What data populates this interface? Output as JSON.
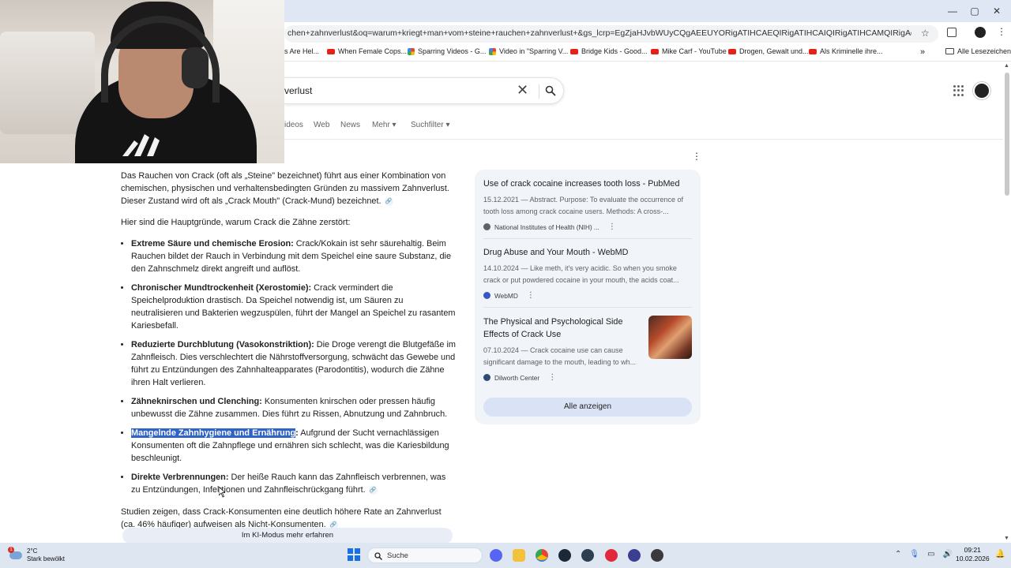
{
  "browser": {
    "url": "chen+zahnverlust&oq=warum+kriegt+man+vom+steine+rauchen+zahnverlust+&gs_lcrp=EgZjaHJvbWUyCQgAEEUYORigATIHCAEQIRigATIHCAIQIRigATIHCAMQIRigAdIBCDc1NzNqMGo3qAIAsAI...",
    "bookmarks": [
      {
        "label": "s Are Hel...",
        "icon": "none"
      },
      {
        "label": "When Female Cops...",
        "icon": "youtube"
      },
      {
        "label": "Sparring Videos - G...",
        "icon": "google-drive"
      },
      {
        "label": "Video in \"Sparring V...",
        "icon": "google-drive"
      },
      {
        "label": "Bridge Kids - Good...",
        "icon": "youtube"
      },
      {
        "label": "Mike Carf - YouTube",
        "icon": "youtube"
      },
      {
        "label": "Drogen, Gewalt und...",
        "icon": "youtube"
      },
      {
        "label": "Als Kriminelle ihre...",
        "icon": "youtube"
      }
    ],
    "bookmarks_more": "»",
    "all_bookmarks": "Alle Lesezeichen",
    "window_controls": {
      "minimize": "—",
      "maximize": "▢",
      "close": "✕"
    }
  },
  "search": {
    "query": "verlust",
    "clear": "✕",
    "tabs": [
      "ideos",
      "Web",
      "News",
      "Mehr ▾",
      "Suchfilter ▾"
    ]
  },
  "main": {
    "intro": "Das Rauchen von Crack (oft als „Steine\" bezeichnet) führt aus einer Kombination von chemischen, physischen und verhaltensbedingten Gründen zu massivem Zahnverlust. Dieser Zustand wird oft als „Crack Mouth\" (Crack-Mund) bezeichnet.",
    "lead": "Hier sind die Hauptgründe, warum Crack die Zähne zerstört:",
    "items": [
      {
        "bold": "Extreme Säure und chemische Erosion:",
        "text": " Crack/Kokain ist sehr säurehaltig. Beim Rauchen bildet der Rauch in Verbindung mit dem Speichel eine saure Substanz, die den Zahnschmelz direkt angreift und auflöst."
      },
      {
        "bold": "Chronischer Mundtrockenheit (Xerostomie):",
        "text": " Crack vermindert die Speichelproduktion drastisch. Da Speichel notwendig ist, um Säuren zu neutralisieren und Bakterien wegzuspülen, führt der Mangel an Speichel zu rasantem Kariesbefall."
      },
      {
        "bold": "Reduzierte Durchblutung (Vasokonstriktion):",
        "text": " Die Droge verengt die Blutgefäße im Zahnfleisch. Dies verschlechtert die Nährstoffversorgung, schwächt das Gewebe und führt zu Entzündungen des Zahnhalteapparates (Parodontitis), wodurch die Zähne ihren Halt verlieren."
      },
      {
        "bold": "Zähneknirschen und Clenching:",
        "text": " Konsumenten knirschen oder pressen häufig unbewusst die Zähne zusammen. Dies führt zu Rissen, Abnutzung und Zahnbruch."
      },
      {
        "bold": "Mangelnde Zahnhygiene und Ernährung",
        "bold_suffix": ":",
        "text": " Aufgrund der Sucht vernachlässigen Konsumenten oft die Zahnpflege und ernähren sich schlecht, was die Kariesbildung beschleunigt."
      },
      {
        "bold": "Direkte Verbrennungen:",
        "text": " Der heiße Rauch kann das Zahnfleisch verbrennen, was zu Entzündungen, Infektionen und Zahnfleischrückgang führt."
      }
    ],
    "outro": "Studien zeigen, dass Crack-Konsumenten eine deutlich höhere Rate an Zahnverlust (ca. 46% häufiger) aufweisen als Nicht-Konsumenten.",
    "ai_mode_button": "Im KI-Modus mehr erfahren"
  },
  "sources": {
    "cards": [
      {
        "title": "Use of crack cocaine increases tooth loss - PubMed",
        "snippet": "15.12.2021 — Abstract. Purpose: To evaluate the occurrence of tooth loss among crack cocaine users. Methods: A cross-...",
        "source": "National Institutes of Health (NIH) ...",
        "color": "#5f6368"
      },
      {
        "title": "Drug Abuse and Your Mouth - WebMD",
        "snippet": "14.10.2024 — Like meth, it's very acidic. So when you smoke crack or put powdered cocaine in your mouth, the acids coat...",
        "source": "WebMD",
        "color": "#3a57c4"
      },
      {
        "title": "The Physical and Psychological Side Effects of Crack Use",
        "snippet": "07.10.2024 — Crack cocaine use can cause significant damage to the mouth, leading to wh...",
        "source": "Dilworth Center",
        "color": "#2f4a73"
      }
    ],
    "show_all": "Alle anzeigen"
  },
  "taskbar": {
    "weather_temp": "2°C",
    "weather_desc": "Stark bewölkt",
    "weather_badge": "1",
    "search_placeholder": "Suche",
    "time": "09:21",
    "date": "10.02.2026"
  }
}
